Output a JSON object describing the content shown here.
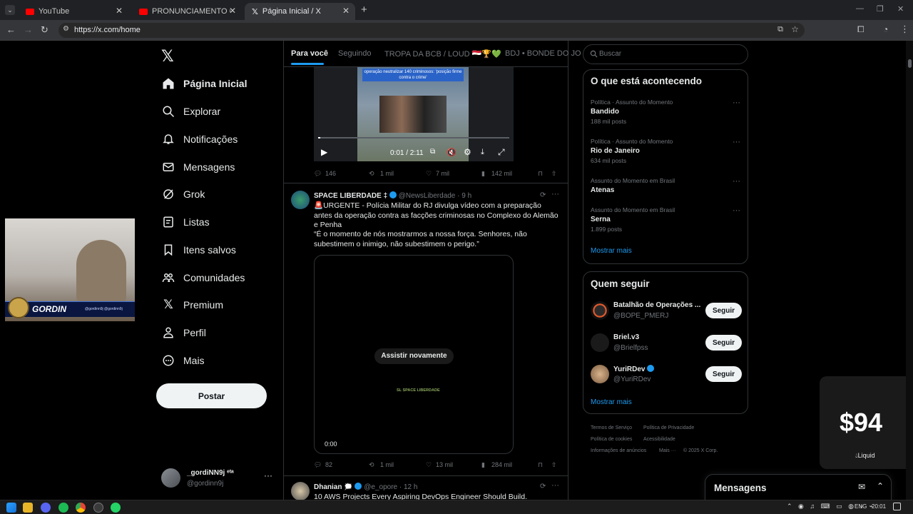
{
  "browser": {
    "tabs": [
      {
        "title": "YouTube"
      },
      {
        "title": "PRONUNCIAMENTO OFICIAL: S"
      },
      {
        "title": "Página Inicial / X"
      }
    ],
    "url": "https://x.com/home"
  },
  "nav": {
    "items": [
      {
        "label": "Página Inicial"
      },
      {
        "label": "Explorar"
      },
      {
        "label": "Notificações"
      },
      {
        "label": "Mensagens"
      },
      {
        "label": "Grok"
      },
      {
        "label": "Listas"
      },
      {
        "label": "Itens salvos"
      },
      {
        "label": "Comunidades"
      },
      {
        "label": "Premium"
      },
      {
        "label": "Perfil"
      },
      {
        "label": "Mais"
      }
    ],
    "post_button": "Postar",
    "account": {
      "name": "_gordiNN9j ᵉᵗᵃ",
      "handle": "@gordinn9j"
    }
  },
  "webcam": {
    "overlay_name": "GORDIN",
    "overlay_sub": "@gordinn9j @gordinn9j"
  },
  "feed": {
    "tabs": [
      "Para você",
      "Seguindo",
      "TROPA DA BCB / LOUD 🇪🇬🏆💚",
      "BDJ • BONDE DO JO"
    ],
    "video1": {
      "caption": "operação neutralizar 140 criminosos: 'posição firme contra o crime'",
      "time": "0:01 / 2:11",
      "progress": 0.01
    },
    "post1_stats": {
      "replies": "146",
      "reposts": "1 mil",
      "likes": "7 mil",
      "views": "142 mil"
    },
    "post2": {
      "name": "SPACE LIBERDADE ‡",
      "handle": "@NewsLiberdade",
      "time": "· 9 h",
      "text1": "🚨URGENTE - Polícia Militar do RJ divulga vídeo com a preparação antes da operação contra as facções criminosas no Complexo do Alemão e Penha",
      "text2": "“É o momento de nós mostrarmos a nossa força. Senhores, não subestimem o inimigo, não subestimem o perigo.”",
      "replay": "Assistir novamente",
      "logo": "SL SPACE LIBERDADE",
      "video_time": "0:00"
    },
    "post2_stats": {
      "replies": "82",
      "reposts": "1 mil",
      "likes": "13 mil",
      "views": "284 mil"
    },
    "post3": {
      "name": "Dhanian 🗯️",
      "handle": "@e_opore",
      "time": "· 12 h",
      "text": "10 AWS Projects Every Aspiring DevOps Engineer Should Build."
    }
  },
  "sidebar": {
    "search_placeholder": "Buscar",
    "trends_title": "O que está acontecendo",
    "trends": [
      {
        "meta": "Política · Assunto do Momento",
        "name": "Bandido",
        "count": "188 mil posts"
      },
      {
        "meta": "Política · Assunto do Momento",
        "name": "Rio de Janeiro",
        "count": "634 mil posts"
      },
      {
        "meta": "Assunto do Momento em Brasil",
        "name": "Atenas",
        "count": ""
      },
      {
        "meta": "Assunto do Momento em Brasil",
        "name": "Serna",
        "count": "1.899 posts"
      }
    ],
    "show_more": "Mostrar mais",
    "who_title": "Quem seguir",
    "who": [
      {
        "name": "Batalhão de Operações ...",
        "handle": "@BOPE_PMERJ",
        "button": "Seguir"
      },
      {
        "name": "Briel.v3",
        "handle": "@Brielfpss",
        "button": "Seguir"
      },
      {
        "name": "YuriRDev",
        "handle": "@YuriRDev",
        "button": "Seguir"
      }
    ],
    "who_more": "Mostrar mais",
    "footer": [
      "Termos de Serviço",
      "Política de Privacidade",
      "Política de cookies",
      "Acessibilidade",
      "Informações de anúncios",
      "Mais ···",
      "© 2025 X Corp."
    ],
    "messages": "Mensagens"
  },
  "overlay_price": {
    "value": "$94",
    "label": "Liquid"
  },
  "taskbar": {
    "lang": "ENG",
    "clock": "20:01"
  },
  "colors": {
    "accent": "#1d9bf0",
    "bg": "#000000",
    "border": "#2f3336"
  }
}
